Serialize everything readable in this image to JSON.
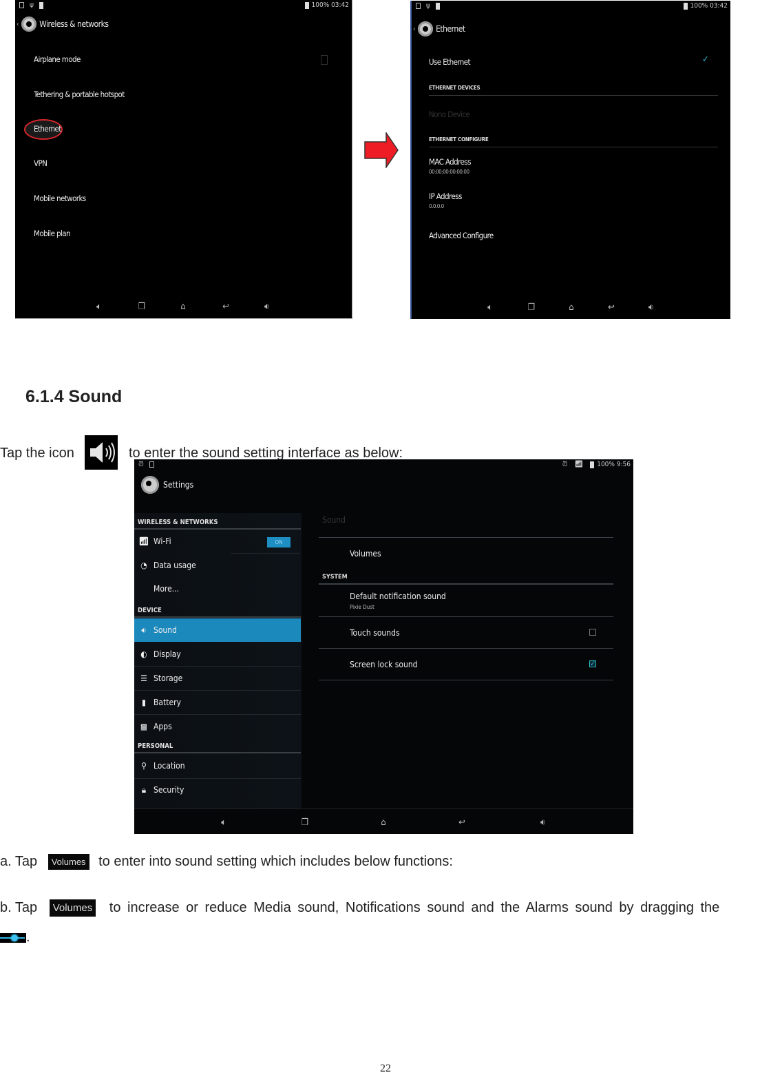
{
  "screen1": {
    "status_time": "100% 03:42",
    "title": "Wireless & networks",
    "items": [
      {
        "label": "Airplane mode"
      },
      {
        "label": "Tethering & portable hotspot"
      },
      {
        "label": "Ethernet"
      },
      {
        "label": "VPN"
      },
      {
        "label": "Mobile networks"
      },
      {
        "label": "Mobile plan"
      }
    ],
    "highlighted_item": "Ethernet",
    "airplane_mode_checked": false
  },
  "arrow": {
    "icon": "right-arrow-icon",
    "color": "#ee1c25"
  },
  "screen2": {
    "status_time": "100% 03:42",
    "title": "Ethernet",
    "use_ethernet_label": "Use Ethernet",
    "use_ethernet_checked": true,
    "devices_header": "ETHERNET DEVICES",
    "devices_value": "Nono Device",
    "configure_header": "ETHERNET CONFIGURE",
    "mac_label": "MAC Address",
    "mac_value": "00:00:00:00:00:00",
    "ip_label": "IP Address",
    "ip_value": "0.0.0.0",
    "advanced_label": "Advanced Configure"
  },
  "doc": {
    "heading": "6.1.4 Sound",
    "intro_before": "Tap the icon",
    "intro_after": "to enter the sound setting interface as below:",
    "step_a_prefix": "a. Tap",
    "step_a_suffix": "to enter into sound setting which includes below functions:",
    "step_b_prefix": "b. Tap",
    "step_b_suffix": "to increase or reduce Media sound, Notifications sound and the Alarms sound by dragging the",
    "step_b_end": ".",
    "volumes_chip": "Volumes",
    "page_number": "22"
  },
  "screen3": {
    "status_time": "100% 9:56",
    "title": "Settings",
    "sections": {
      "wireless": "WIRELESS & NETWORKS",
      "device": "DEVICE",
      "personal": "PERSONAL"
    },
    "wifi_label": "Wi-Fi",
    "wifi_toggle": "ON",
    "data_usage_label": "Data usage",
    "more_label": "More...",
    "sound_label": "Sound",
    "display_label": "Display",
    "storage_label": "Storage",
    "battery_label": "Battery",
    "apps_label": "Apps",
    "location_label": "Location",
    "security_label": "Security",
    "selected_item": "Sound",
    "right": {
      "title": "Sound",
      "volumes_label": "Volumes",
      "system_header": "SYSTEM",
      "default_notif_label": "Default notification sound",
      "default_notif_value": "Pixie Dust",
      "touch_sounds_label": "Touch sounds",
      "touch_sounds_checked": false,
      "screen_lock_label": "Screen lock sound",
      "screen_lock_checked": true
    },
    "accent_color": "#1c89bd"
  }
}
